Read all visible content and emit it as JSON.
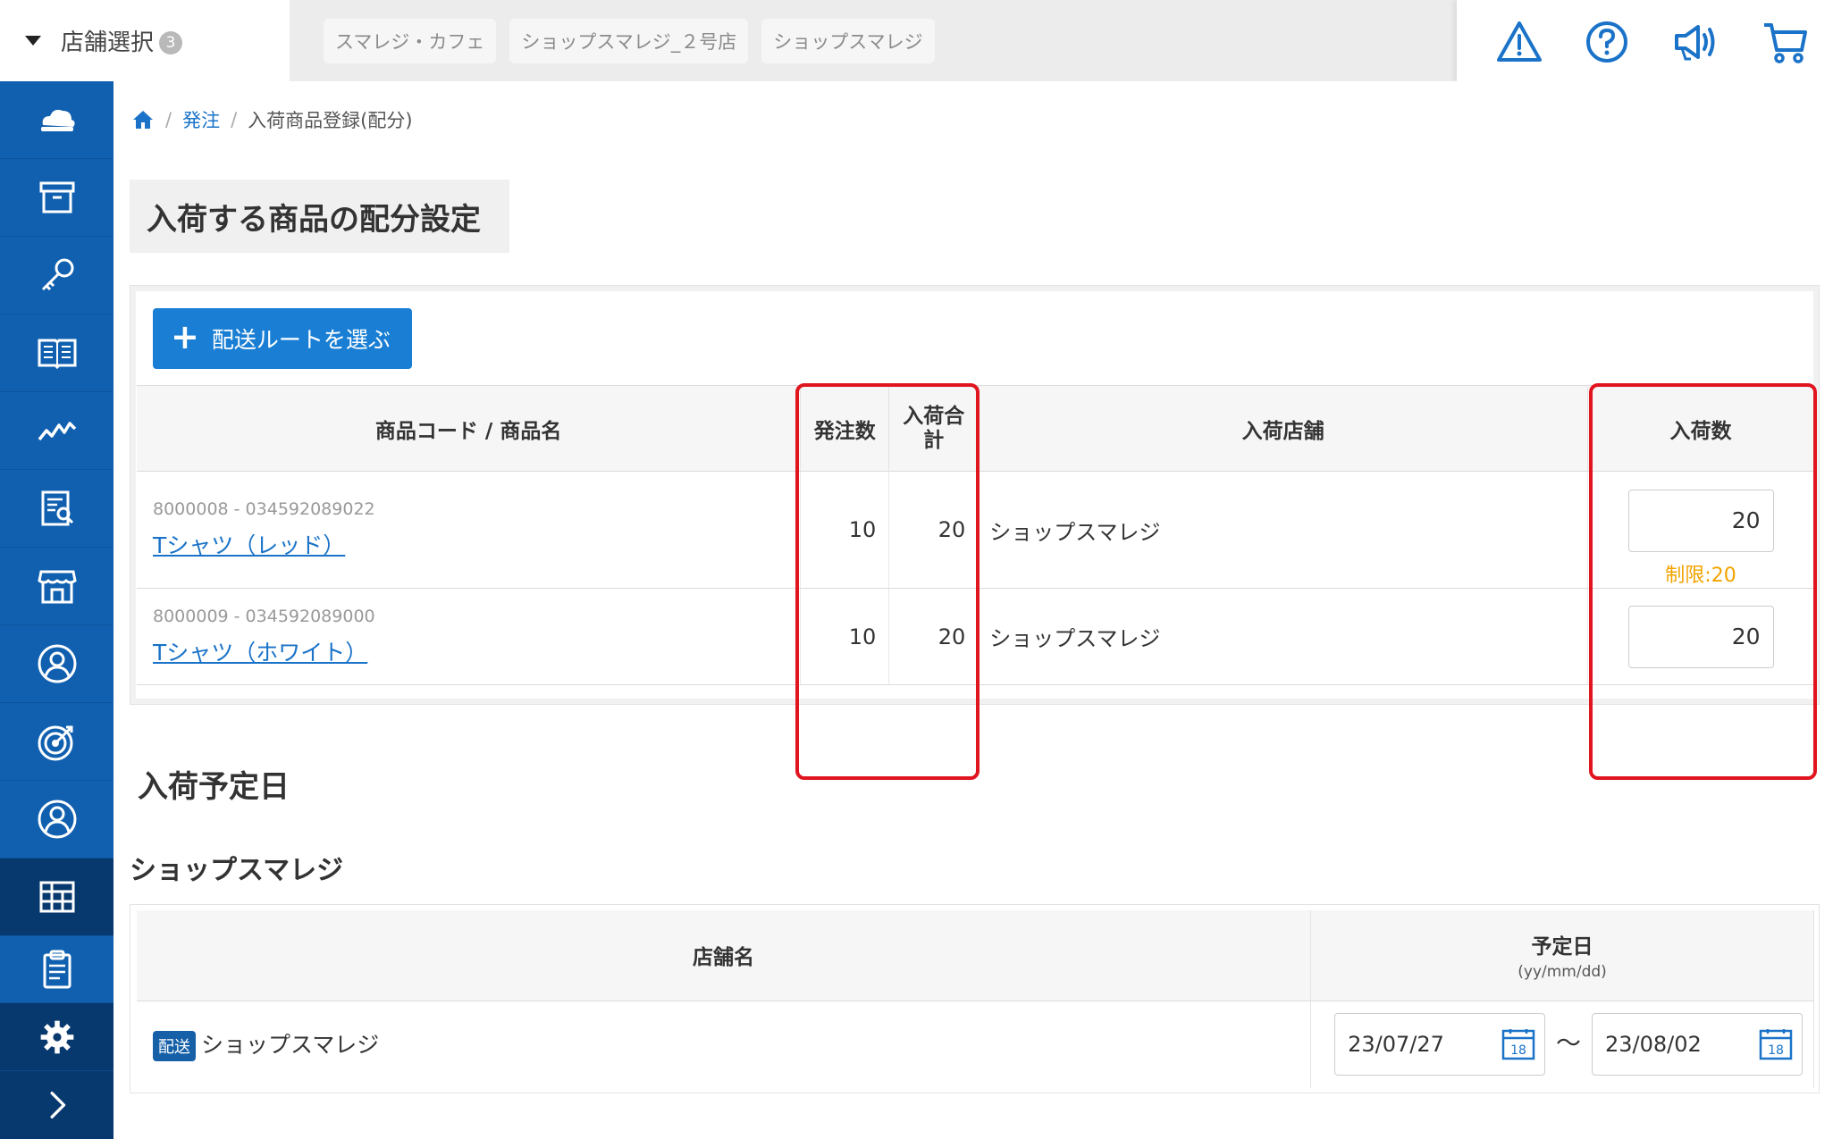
{
  "header": {
    "store_select_label": "店舗選択",
    "store_select_count": "3",
    "store_tabs": [
      "スマレジ・カフェ",
      "ショップスマレジ_２号店",
      "ショップスマレジ"
    ],
    "icons": [
      "warning-icon",
      "help-icon",
      "announcement-icon",
      "cart-icon"
    ]
  },
  "sidebar": {
    "items": [
      "cloud-icon",
      "archive-icon",
      "key-icon",
      "book-icon",
      "chart-icon",
      "report-icon",
      "store-icon",
      "customer-icon",
      "target-icon",
      "user-icon",
      "grid-icon",
      "clipboard-icon"
    ],
    "active_item": "grid-icon",
    "bottom": [
      "gear-icon",
      "chevron-right-icon"
    ]
  },
  "breadcrumb": {
    "home_icon": "home-icon",
    "order_link": "発注",
    "current": "入荷商品登録(配分)"
  },
  "page_title": "入荷する商品の配分設定",
  "add_route_button": "配送ルートを選ぶ",
  "items_table": {
    "headers": {
      "product": "商品コード / 商品名",
      "order_qty": "発注数",
      "arrival_total": "入荷合計",
      "arrival_store": "入荷店舗",
      "arrival_qty": "入荷数"
    },
    "rows": [
      {
        "code": "8000008 - 034592089022",
        "name": "Tシャツ（レッド）",
        "order_qty": "10",
        "arrival_total": "20",
        "store": "ショップスマレジ",
        "qty": "20",
        "limit": "制限:20"
      },
      {
        "code": "8000009 - 034592089000",
        "name": "Tシャツ（ホワイト）",
        "order_qty": "10",
        "arrival_total": "20",
        "store": "ショップスマレジ",
        "qty": "20",
        "limit": ""
      }
    ]
  },
  "schedule": {
    "section_title": "入荷予定日",
    "store_group": "ショップスマレジ",
    "headers": {
      "store_name": "店舗名",
      "planned_date": "予定日",
      "date_format": "(yy/mm/dd)"
    },
    "rows": [
      {
        "badge": "配送",
        "store": "ショップスマレジ",
        "from": "23/07/27",
        "tilde": "～",
        "to": "23/08/02",
        "calendar_day": "18"
      }
    ]
  },
  "colors": {
    "sidebar": "#1160b0",
    "sidebar_active": "#07396e",
    "primary_button": "#1a7fd4",
    "link": "#1a73c8",
    "limit_text": "#f2a300",
    "highlight_box": "#e0151f"
  }
}
